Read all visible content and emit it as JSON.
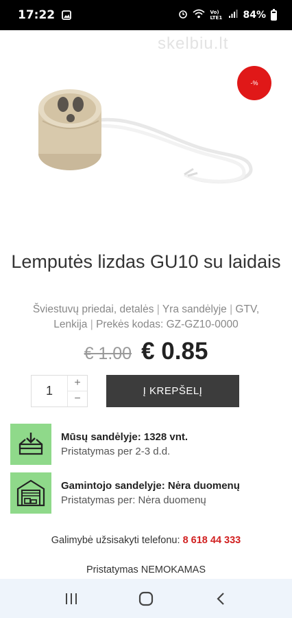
{
  "status_bar": {
    "time": "17:22",
    "network": "Vo) LTE1",
    "battery": "84%"
  },
  "hero": {
    "watermark": "skelbiu.lt",
    "discount_badge": "-%"
  },
  "product": {
    "title": "Lemputės lizdas GU10 su laidais",
    "meta_parts": [
      "Šviestuvų priedai, detalės",
      "Yra sandėlyje",
      "GTV, Lenkija",
      "Prekės kodas: GZ-GZ10-0000"
    ],
    "old_price": "€ 1.00",
    "new_price": "€ 0.85"
  },
  "cart": {
    "quantity": "1",
    "plus": "+",
    "minus": "−",
    "button_label": "Į KREPŠELĮ"
  },
  "stock": [
    {
      "title": "Mūsų sandėlyje: 1328 vnt.",
      "subtitle": "Pristatymas per 2-3 d.d.",
      "icon": "warehouse-box-icon"
    },
    {
      "title": "Gamintojo sandelyje: Nėra duomenų",
      "subtitle": "Pristatymas per: Nėra duomenų",
      "icon": "factory-garage-icon"
    }
  ],
  "contact": {
    "label": "Galimybė užsisakyti telefonu:",
    "phone": "8 618 44 333"
  },
  "delivery": "Pristatymas NEMOKAMAS",
  "colors": {
    "accent_red": "#e01818",
    "stock_green": "#8fd98a",
    "cart_button": "#3c3c3c"
  }
}
